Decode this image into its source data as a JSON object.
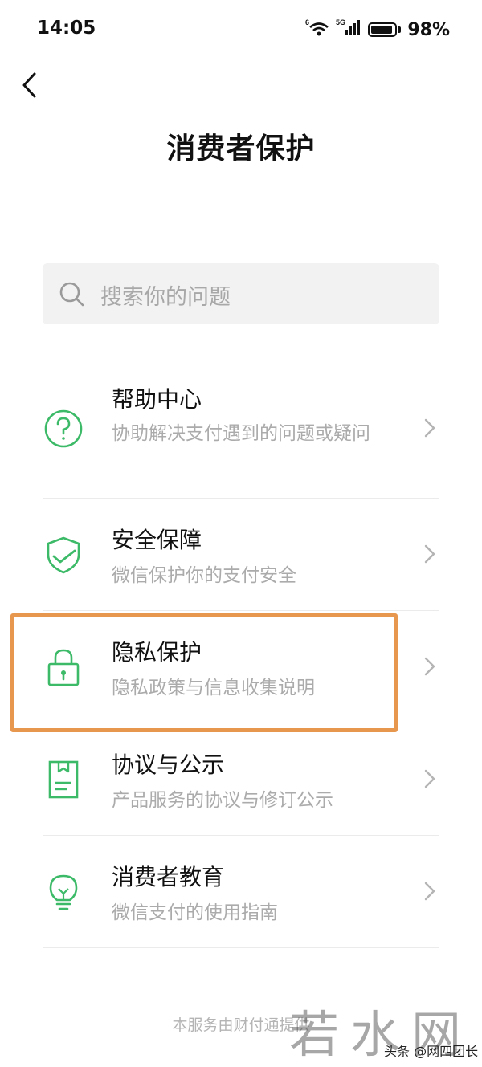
{
  "status_bar": {
    "time": "14:05",
    "signal_label": "5G",
    "wifi_label": "6",
    "battery": "98%"
  },
  "header": {
    "title": "消费者保护"
  },
  "search": {
    "placeholder": "搜索你的问题"
  },
  "items": [
    {
      "title": "帮助中心",
      "desc": "协助解决支付遇到的问题或疑问",
      "icon": "help-circle-icon"
    },
    {
      "title": "安全保障",
      "desc": "微信保护你的支付安全",
      "icon": "shield-check-icon"
    },
    {
      "title": "隐私保护",
      "desc": "隐私政策与信息收集说明",
      "icon": "lock-icon"
    },
    {
      "title": "协议与公示",
      "desc": "产品服务的协议与修订公示",
      "icon": "document-icon"
    },
    {
      "title": "消费者教育",
      "desc": "微信支付的使用指南",
      "icon": "lightbulb-icon"
    }
  ],
  "footer": {
    "text": "本服务由财付通提供"
  },
  "watermark": {
    "big": "若水网",
    "small": "头条 @网四团长"
  },
  "colors": {
    "accent_green": "#3dba68",
    "highlight_orange": "#e8974e"
  }
}
